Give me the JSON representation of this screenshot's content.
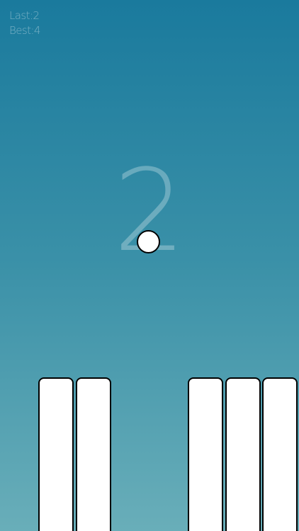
{
  "hud": {
    "last_label": "Last:",
    "last_value": "2",
    "best_label": "Best:",
    "best_value": "4"
  },
  "score": "2",
  "colors": {
    "background_top": "#1a7a9d",
    "background_bottom": "#69aeb9",
    "key": "#ffffff",
    "ball": "#ffffff",
    "outline": "#000000"
  },
  "keys": {
    "count": 5
  }
}
